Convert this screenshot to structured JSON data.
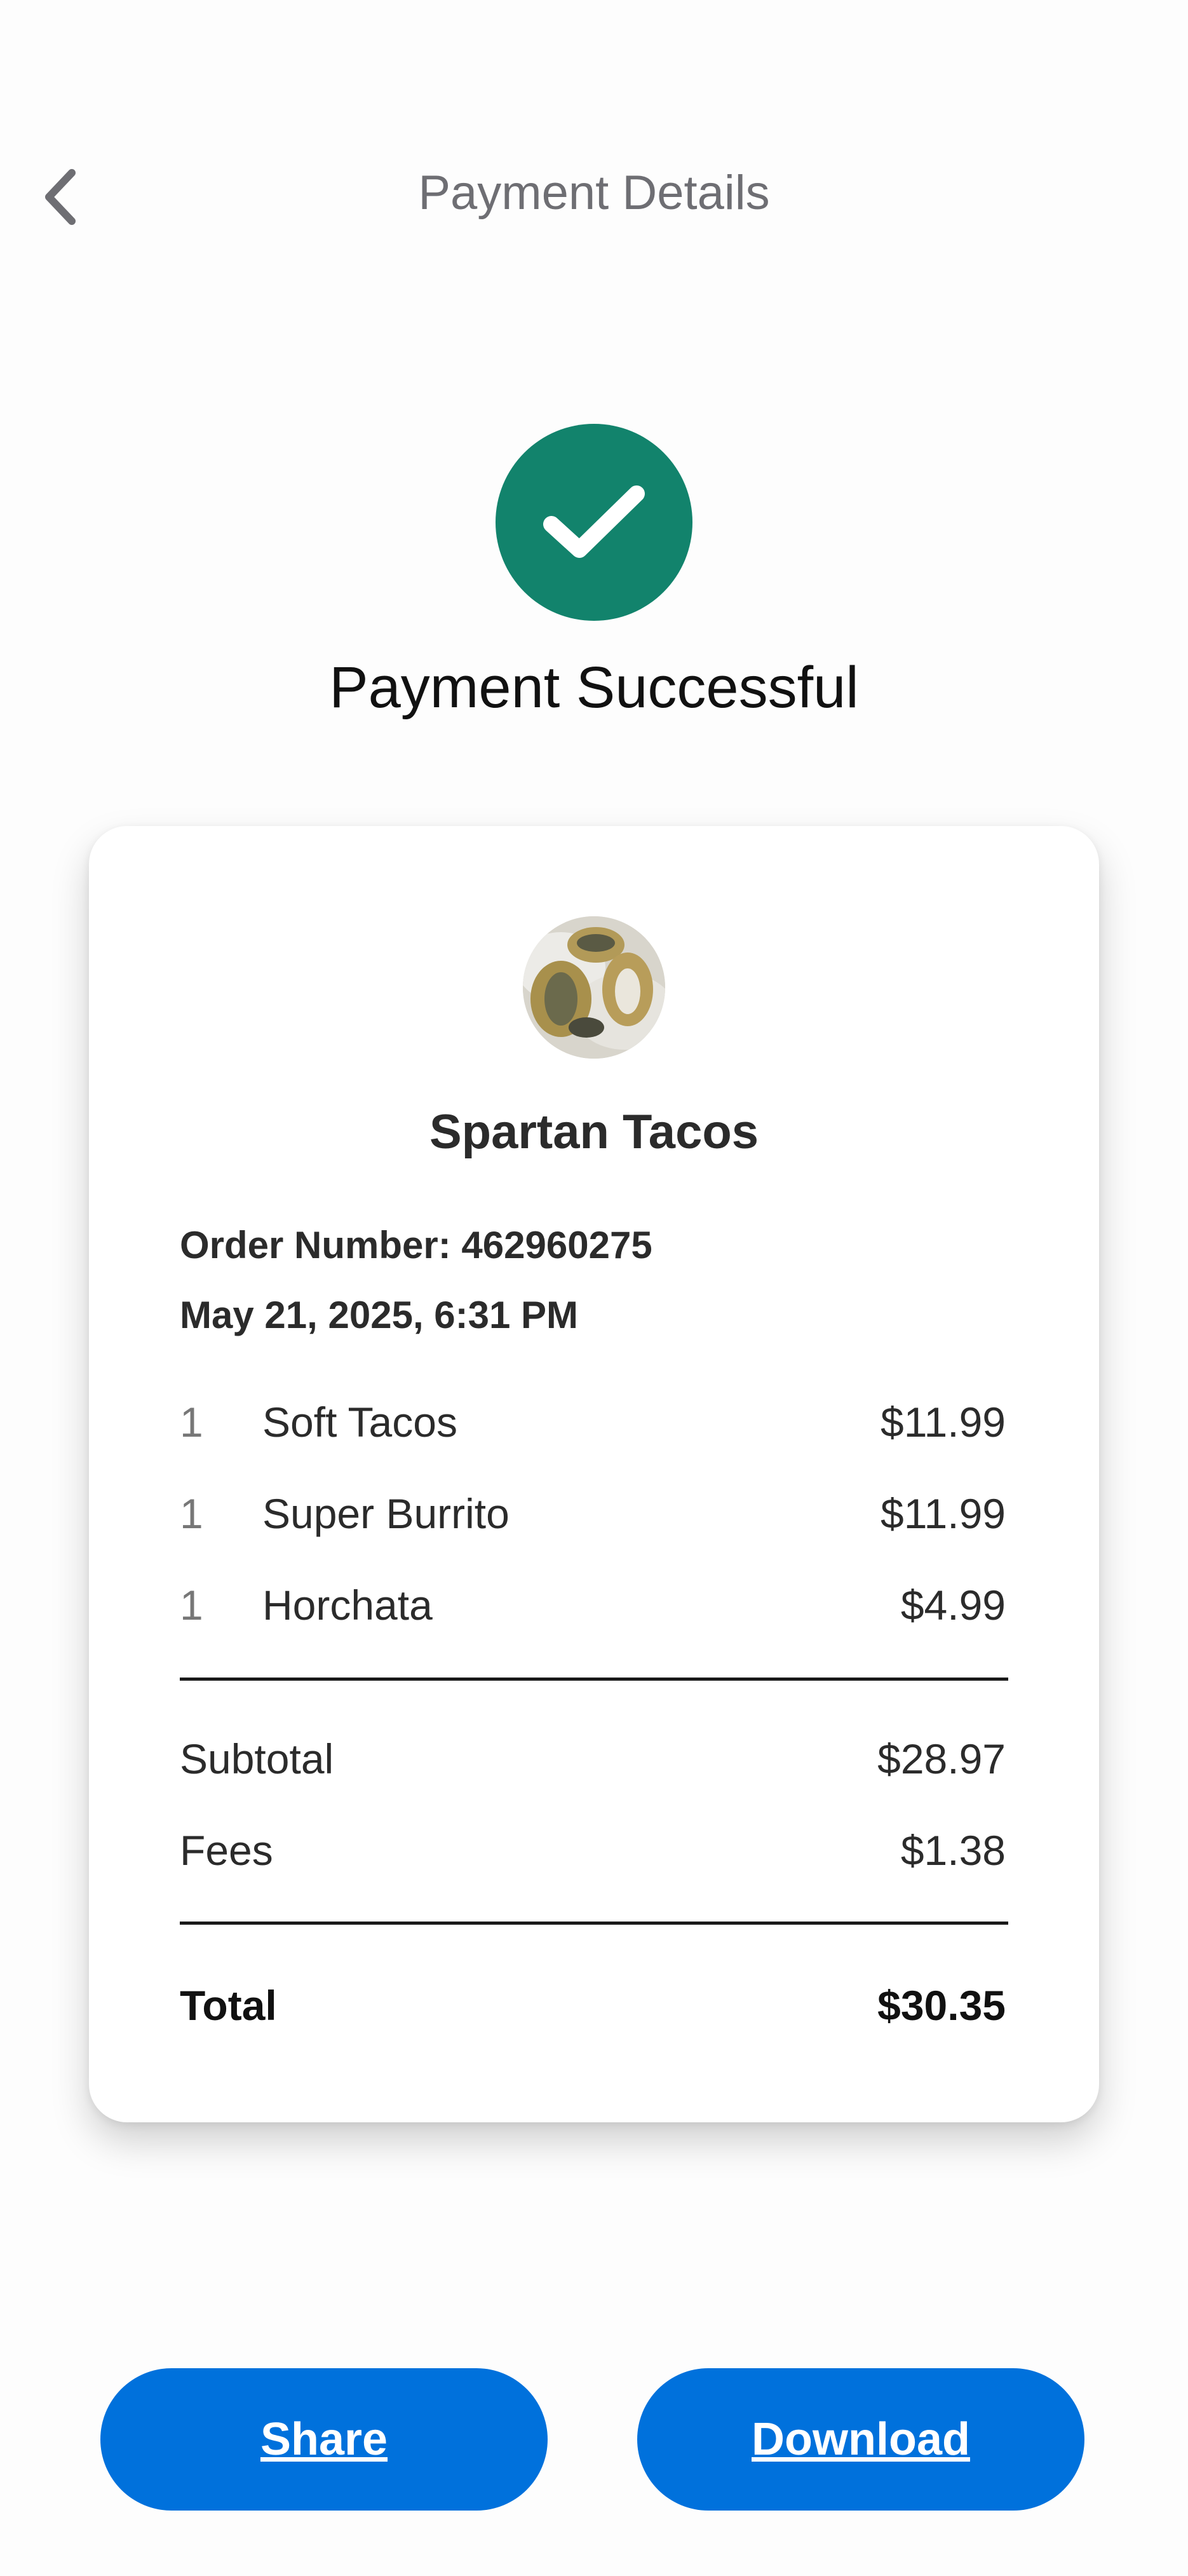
{
  "header": {
    "title": "Payment Details",
    "back_icon": "chevron-left-icon"
  },
  "status": {
    "icon": "check-icon",
    "title": "Payment Successful",
    "color": "#12836c"
  },
  "receipt": {
    "restaurant_name": "Spartan Tacos",
    "order_number_label": "Order Number: 462960275",
    "date": "May 21, 2025, 6:31 PM",
    "items": [
      {
        "qty": "1",
        "name": "Soft Tacos",
        "price": "$11.99"
      },
      {
        "qty": "1",
        "name": "Super Burrito",
        "price": "$11.99"
      },
      {
        "qty": "1",
        "name": "Horchata",
        "price": "$4.99"
      }
    ],
    "subtotal_label": "Subtotal",
    "subtotal_value": "$28.97",
    "fees_label": "Fees",
    "fees_value": "$1.38",
    "total_label": "Total",
    "total_value": "$30.35"
  },
  "actions": {
    "share_label": "Share",
    "download_label": "Download",
    "button_color": "#0071dc"
  }
}
